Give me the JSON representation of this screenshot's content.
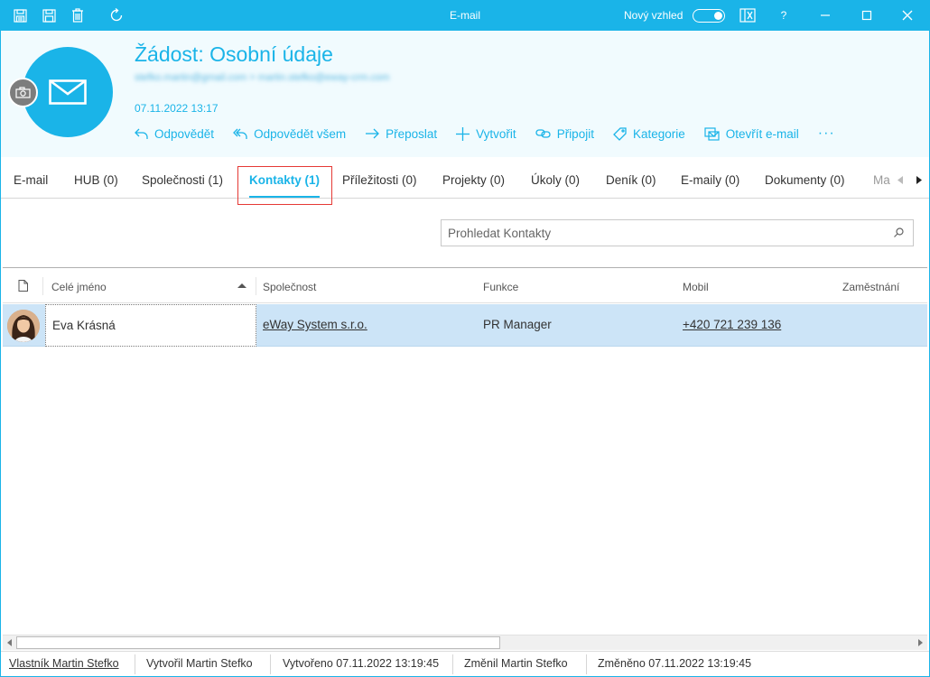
{
  "window": {
    "title": "E-mail",
    "new_look_label": "Nový vzhled",
    "help_label": "?",
    "accent_color": "#1ab4e8"
  },
  "header": {
    "subject": "Žádost: Osobní údaje",
    "addresses": "stefko.martin@gmail.com > martin.stefko@eway-crm.com",
    "date": "07.11.2022 13:17",
    "actions": [
      {
        "label": "Odpovědět",
        "icon": "reply-icon"
      },
      {
        "label": "Odpovědět všem",
        "icon": "reply-all-icon"
      },
      {
        "label": "Přeposlat",
        "icon": "forward-icon"
      },
      {
        "label": "Vytvořit",
        "icon": "plus-icon"
      },
      {
        "label": "Připojit",
        "icon": "link-icon"
      },
      {
        "label": "Kategorie",
        "icon": "tag-icon"
      },
      {
        "label": "Otevřít e-mail",
        "icon": "open-email-icon"
      }
    ],
    "more_label": "···"
  },
  "tabs": [
    {
      "label": "E-mail"
    },
    {
      "label": "HUB (0)"
    },
    {
      "label": "Společnosti (1)"
    },
    {
      "label": "Kontakty (1)"
    },
    {
      "label": "Příležitosti (0)"
    },
    {
      "label": "Projekty (0)"
    },
    {
      "label": "Úkoly (0)"
    },
    {
      "label": "Deník (0)"
    },
    {
      "label": "E-maily (0)"
    },
    {
      "label": "Dokumenty (0)"
    },
    {
      "label": "Ma"
    }
  ],
  "search": {
    "placeholder": "Prohledat Kontakty"
  },
  "grid": {
    "columns": [
      "Celé jméno",
      "Společnost",
      "Funkce",
      "Mobil",
      "Zaměstnání"
    ],
    "rows": [
      {
        "name": "Eva Krásná",
        "company": "eWay System s.r.o.",
        "function": "PR Manager",
        "mobile": "+420 721 239 136",
        "employment": ""
      }
    ]
  },
  "status": {
    "owner": "Vlastník Martin Stefko",
    "created_by": "Vytvořil Martin Stefko",
    "created_at": "Vytvořeno 07.11.2022 13:19:45",
    "changed_by": "Změnil Martin Stefko",
    "changed_at": "Změněno 07.11.2022 13:19:45"
  }
}
